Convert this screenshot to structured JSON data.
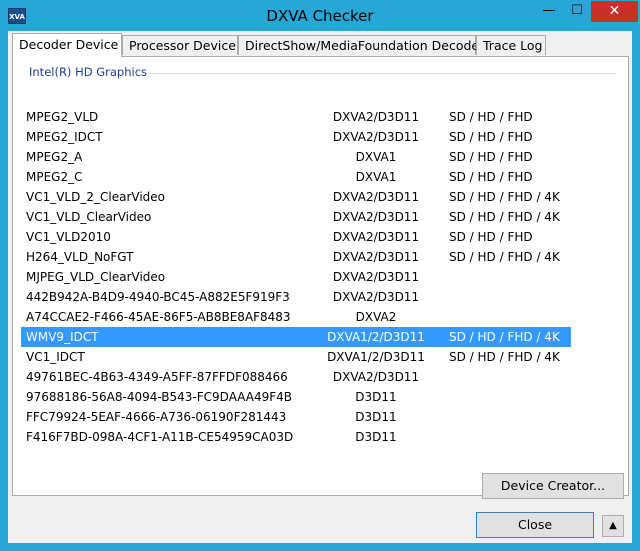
{
  "app": {
    "title": "DXVA Checker",
    "icon_text": "XVA"
  },
  "title_controls": {
    "minimize": "—",
    "maximize": "☐",
    "close": "✕"
  },
  "tabs": [
    {
      "label": "Decoder Device",
      "active": true
    },
    {
      "label": "Processor Device",
      "active": false
    },
    {
      "label": "DirectShow/MediaFoundation Decoder",
      "active": false
    },
    {
      "label": "Trace Log",
      "active": false
    }
  ],
  "group": {
    "label": "Intel(R) HD Graphics"
  },
  "rows": [
    {
      "name": "MPEG2_VLD",
      "api": "DXVA2/D3D11",
      "res": "SD / HD / FHD"
    },
    {
      "name": "MPEG2_IDCT",
      "api": "DXVA2/D3D11",
      "res": "SD / HD / FHD"
    },
    {
      "name": "MPEG2_A",
      "api": "DXVA1",
      "res": "SD / HD / FHD"
    },
    {
      "name": "MPEG2_C",
      "api": "DXVA1",
      "res": "SD / HD / FHD"
    },
    {
      "name": "VC1_VLD_2_ClearVideo",
      "api": "DXVA2/D3D11",
      "res": "SD / HD / FHD / 4K"
    },
    {
      "name": "VC1_VLD_ClearVideo",
      "api": "DXVA2/D3D11",
      "res": "SD / HD / FHD / 4K"
    },
    {
      "name": "VC1_VLD2010",
      "api": "DXVA2/D3D11",
      "res": "SD / HD / FHD"
    },
    {
      "name": "H264_VLD_NoFGT",
      "api": "DXVA2/D3D11",
      "res": "SD / HD / FHD / 4K"
    },
    {
      "name": "MJPEG_VLD_ClearVideo",
      "api": "DXVA2/D3D11",
      "res": ""
    },
    {
      "name": "442B942A-B4D9-4940-BC45-A882E5F919F3",
      "api": "DXVA2/D3D11",
      "res": ""
    },
    {
      "name": "A74CCAE2-F466-45AE-86F5-AB8BE8AF8483",
      "api": "DXVA2",
      "res": ""
    },
    {
      "name": "WMV9_IDCT",
      "api": "DXVA1/2/D3D11",
      "res": "SD / HD / FHD / 4K",
      "selected": true
    },
    {
      "name": "VC1_IDCT",
      "api": "DXVA1/2/D3D11",
      "res": "SD / HD / FHD / 4K"
    },
    {
      "name": "49761BEC-4B63-4349-A5FF-87FFDF088466",
      "api": "DXVA2/D3D11",
      "res": ""
    },
    {
      "name": "97688186-56A8-4094-B543-FC9DAAA49F4B",
      "api": "D3D11",
      "res": ""
    },
    {
      "name": "FFC79924-5EAF-4666-A736-06190F281443",
      "api": "D3D11",
      "res": ""
    },
    {
      "name": "F416F7BD-098A-4CF1-A11B-CE54959CA03D",
      "api": "D3D11",
      "res": ""
    }
  ],
  "buttons": {
    "device_creator": "Device Creator...",
    "close": "Close",
    "expand": "▲"
  },
  "colors": {
    "accent": "#27a7d8",
    "selection": "#3399ff",
    "group_label": "#1c3f94"
  }
}
